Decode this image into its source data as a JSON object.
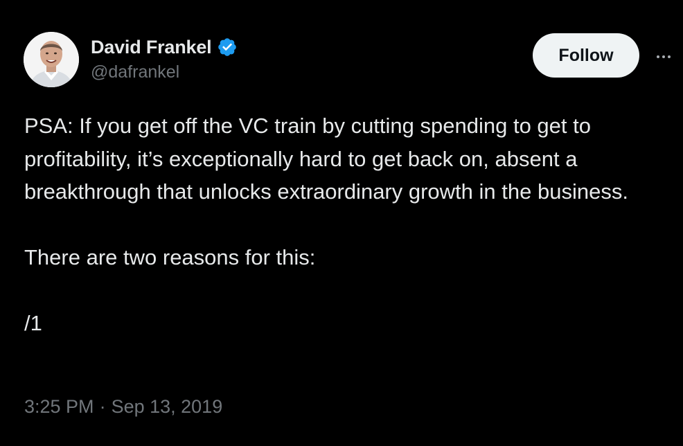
{
  "author": {
    "display_name": "David Frankel",
    "handle": "@dafrankel",
    "verified_icon": "verified-badge-icon",
    "avatar": "avatar-photo"
  },
  "actions": {
    "follow_label": "Follow",
    "more_icon": "more-horizontal-icon"
  },
  "tweet": {
    "paragraphs": [
      "PSA: If you get off the VC train by cutting spending to get to profitability, it’s exceptionally hard to get back on, absent a breakthrough that unlocks extraordinary growth in the business.",
      "There are two reasons for this:",
      "/1"
    ],
    "time": "3:25 PM",
    "separator": "·",
    "date": "Sep 13, 2019"
  },
  "colors": {
    "background": "#000000",
    "primary_text": "#e7e9ea",
    "secondary_text": "#71767b",
    "verified_blue": "#1d9bf0",
    "follow_bg": "#eff3f4",
    "follow_text": "#0f1419"
  }
}
